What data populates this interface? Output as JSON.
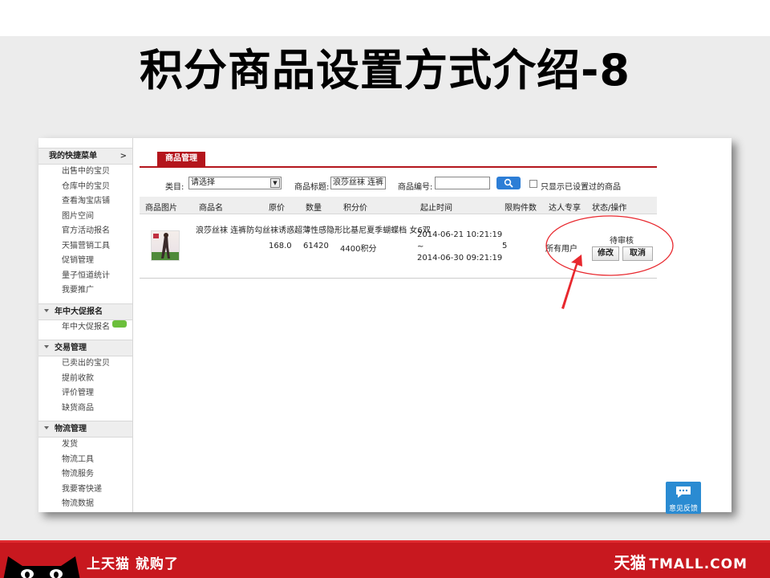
{
  "slide": {
    "title": "积分商品设置方式介绍-8"
  },
  "sidebar": {
    "quick_menu": {
      "title": "我的快捷菜单",
      "chevron": ">",
      "items": [
        "出售中的宝贝",
        "仓库中的宝贝",
        "查看淘宝店铺",
        "图片空间",
        "官方活动报名",
        "天猫营销工具",
        "促销管理",
        "量子恒道统计",
        "我要推广"
      ]
    },
    "promo": {
      "title": "年中大促报名",
      "items": [
        "年中大促报名"
      ]
    },
    "trade": {
      "title": "交易管理",
      "items": [
        "已卖出的宝贝",
        "提前收款",
        "评价管理",
        "缺货商品"
      ]
    },
    "logistics": {
      "title": "物流管理",
      "items": [
        "发货",
        "物流工具",
        "物流服务",
        "我要寄快递",
        "物流数据"
      ]
    }
  },
  "main": {
    "tab_label": "商品管理",
    "filters": {
      "category_label": "类目:",
      "category_value": "请选择",
      "title_label": "商品标题:",
      "title_value": "浪莎丝袜 连裤",
      "id_label": "商品编号:",
      "id_value": "",
      "only_set_label": "只显示已设置过的商品"
    },
    "table": {
      "headers": [
        "商品图片",
        "商品名",
        "原价",
        "数量",
        "积分价",
        "起止时间",
        "限购件数",
        "达人专享",
        "状态/操作"
      ],
      "rows": [
        {
          "name": "浪莎丝袜 连裤防勾丝袜诱惑超薄性感隐形比基尼夏季蝴蝶档 女6双",
          "price": "168.0",
          "quantity": "61420",
          "points_price": "4400积分",
          "start_time": "2014-06-21 10:21:19",
          "time_sep": "~",
          "end_time": "2014-06-30 09:21:19",
          "limit": "5",
          "vip": "所有用户",
          "status": "待审核",
          "edit_label": "修改",
          "cancel_label": "取消"
        }
      ]
    },
    "feedback_label": "意见反馈"
  },
  "footer": {
    "slogan": "上天猫  就购了",
    "brand_cn": "天猫",
    "brand_en": "TMALL.COM"
  },
  "colors": {
    "brand_red": "#c8181f",
    "tab_red": "#b4151c",
    "annotation_red": "#e8282e",
    "search_blue": "#2d7ed6"
  }
}
